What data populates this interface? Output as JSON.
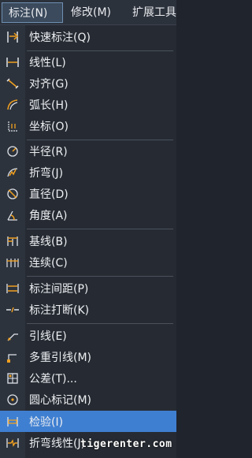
{
  "menubar": {
    "items": [
      {
        "label": "标注(N)"
      },
      {
        "label": "修改(M)"
      },
      {
        "label": "扩展工具"
      }
    ]
  },
  "menu": {
    "items": [
      {
        "label": "快速标注(Q)",
        "icon": "quick-dimension-icon"
      },
      {
        "label": "线性(L)",
        "icon": "linear-dimension-icon"
      },
      {
        "label": "对齐(G)",
        "icon": "aligned-dimension-icon"
      },
      {
        "label": "弧长(H)",
        "icon": "arc-length-icon"
      },
      {
        "label": "坐标(O)",
        "icon": "ordinate-icon"
      },
      {
        "label": "半径(R)",
        "icon": "radius-icon"
      },
      {
        "label": "折弯(J)",
        "icon": "jogged-icon"
      },
      {
        "label": "直径(D)",
        "icon": "diameter-icon"
      },
      {
        "label": "角度(A)",
        "icon": "angular-icon"
      },
      {
        "label": "基线(B)",
        "icon": "baseline-icon"
      },
      {
        "label": "连续(C)",
        "icon": "continue-icon"
      },
      {
        "label": "标注间距(P)",
        "icon": "dimension-space-icon"
      },
      {
        "label": "标注打断(K)",
        "icon": "dimension-break-icon"
      },
      {
        "label": "引线(E)",
        "icon": "leader-icon"
      },
      {
        "label": "多重引线(M)",
        "icon": "multileader-icon"
      },
      {
        "label": "公差(T)...",
        "icon": "tolerance-icon"
      },
      {
        "label": "圆心标记(M)",
        "icon": "center-mark-icon"
      },
      {
        "label": "检验(I)",
        "icon": "inspection-icon"
      },
      {
        "label": "折弯线性(J)",
        "icon": "jogged-linear-icon"
      }
    ],
    "highlighted_index": 17
  },
  "colors": {
    "accent": "#3f7fd1",
    "icon_orange": "#f0a020",
    "icon_light": "#dfe3ea"
  },
  "watermark": "tigerenter.com"
}
